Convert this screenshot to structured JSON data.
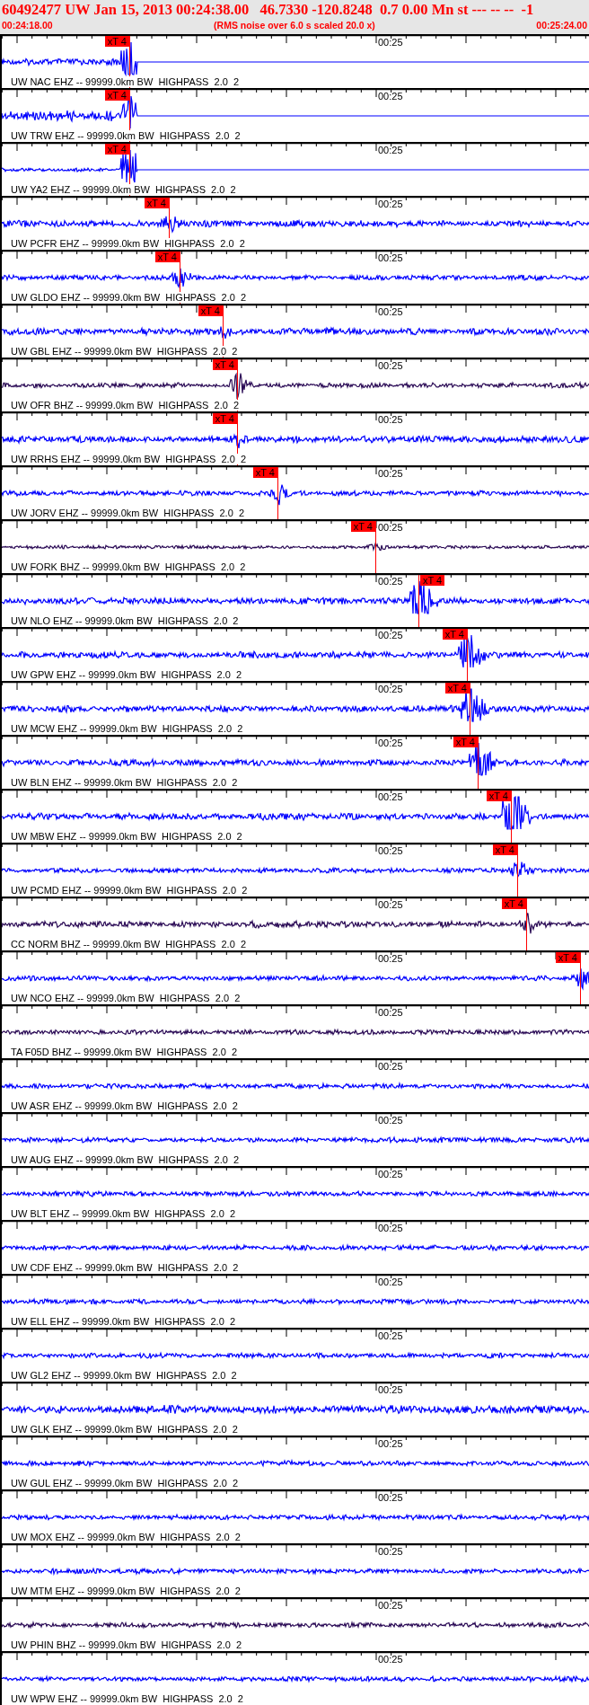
{
  "header": {
    "title": "60492477 UW Jan 15, 2013 00:24:38.00   46.7330 -120.8248  0.7 0.00 Mn st --- -- --  -1",
    "start_time": "00:24:18.00",
    "note": "(RMS noise over 6.0 s scaled 20.0 x)",
    "end_time": "00:25:24.00"
  },
  "traces": [
    {
      "label": "UW NAC EHZ -- 99999.0km BW  HIGHPASS  2.0  2",
      "tick_label": "00:25",
      "pick": "xT 4",
      "color": "#0000ff"
    },
    {
      "label": "UW TRW EHZ -- 99999.0km BW  HIGHPASS  2.0  2",
      "tick_label": "00:25",
      "pick": "xT 4",
      "color": "#0000ff"
    },
    {
      "label": "UW YA2 EHZ -- 99999.0km BW  HIGHPASS  2.0  2",
      "tick_label": "00:25",
      "pick": "xT 4",
      "color": "#0000ff"
    },
    {
      "label": "UW PCFR EHZ -- 99999.0km BW  HIGHPASS  2.0  2",
      "tick_label": "00:25",
      "pick": "xT 4",
      "color": "#0000ff"
    },
    {
      "label": "UW GLDO EHZ -- 99999.0km BW  HIGHPASS  2.0  2",
      "tick_label": "00:25",
      "pick": "xT 4",
      "color": "#0000ff"
    },
    {
      "label": "UW GBL EHZ -- 99999.0km BW  HIGHPASS  2.0  2",
      "tick_label": "00:25",
      "pick": "xT 4",
      "color": "#0000ff"
    },
    {
      "label": "UW OFR BHZ -- 99999.0km BW  HIGHPASS  2.0  2",
      "tick_label": "00:25",
      "pick": "xT 4",
      "color": "#2a0a55"
    },
    {
      "label": "UW RRHS EHZ -- 99999.0km BW  HIGHPASS  2.0  2",
      "tick_label": "00:25",
      "pick": "xT 4",
      "color": "#0000ff"
    },
    {
      "label": "UW JORV EHZ -- 99999.0km BW  HIGHPASS  2.0  2",
      "tick_label": "00:25",
      "pick": "xT 4",
      "color": "#0000ff"
    },
    {
      "label": "UW FORK BHZ -- 99999.0km BW  HIGHPASS  2.0  2",
      "tick_label": "00:25",
      "pick": "xT 4",
      "color": "#2a0a55"
    },
    {
      "label": "UW NLO EHZ -- 99999.0km BW  HIGHPASS  2.0  2",
      "tick_label": "00:25",
      "pick": "xT 4",
      "color": "#0000ff"
    },
    {
      "label": "UW GPW EHZ -- 99999.0km BW  HIGHPASS  2.0  2",
      "tick_label": "00:25",
      "pick": "xT 4",
      "color": "#0000ff"
    },
    {
      "label": "UW MCW EHZ -- 99999.0km BW  HIGHPASS  2.0  2",
      "tick_label": "00:25",
      "pick": "xT 4",
      "color": "#0000ff"
    },
    {
      "label": "UW BLN EHZ -- 99999.0km BW  HIGHPASS  2.0  2",
      "tick_label": "00:25",
      "pick": "xT 4",
      "color": "#0000ff"
    },
    {
      "label": "UW MBW EHZ -- 99999.0km BW  HIGHPASS  2.0  2",
      "tick_label": "00:25",
      "pick": "xT 4",
      "color": "#0000ff"
    },
    {
      "label": "UW PCMD EHZ -- 99999.0km BW  HIGHPASS  2.0  2",
      "tick_label": "00:25",
      "pick": "xT 4",
      "color": "#0000ff"
    },
    {
      "label": "CC NORM BHZ -- 99999.0km BW  HIGHPASS  2.0  2",
      "tick_label": "00:25",
      "pick": "xT 4",
      "color": "#2a0a55"
    },
    {
      "label": "UW NCO EHZ -- 99999.0km BW  HIGHPASS  2.0  2",
      "tick_label": "00:25",
      "pick": "xT 4",
      "color": "#0000ff"
    },
    {
      "label": "TA F05D BHZ -- 99999.0km BW  HIGHPASS  2.0  2",
      "tick_label": "00:25",
      "color": "#2a0a55"
    },
    {
      "label": "UW ASR EHZ -- 99999.0km BW  HIGHPASS  2.0  2",
      "tick_label": "00:25",
      "color": "#0000ff"
    },
    {
      "label": "UW AUG EHZ -- 99999.0km BW  HIGHPASS  2.0  2",
      "tick_label": "00:25",
      "color": "#0000ff"
    },
    {
      "label": "UW BLT EHZ -- 99999.0km BW  HIGHPASS  2.0  2",
      "tick_label": "00:25",
      "color": "#0000ff"
    },
    {
      "label": "UW CDF EHZ -- 99999.0km BW  HIGHPASS  2.0  2",
      "tick_label": "00:25",
      "color": "#0000ff"
    },
    {
      "label": "UW ELL EHZ -- 99999.0km BW  HIGHPASS  2.0  2",
      "tick_label": "00:25",
      "color": "#0000ff"
    },
    {
      "label": "UW GL2 EHZ -- 99999.0km BW  HIGHPASS  2.0  2",
      "tick_label": "00:25",
      "color": "#0000ff"
    },
    {
      "label": "UW GLK EHZ -- 99999.0km BW  HIGHPASS  2.0  2",
      "tick_label": "00:25",
      "color": "#0000ff"
    },
    {
      "label": "UW GUL EHZ -- 99999.0km BW  HIGHPASS  2.0  2",
      "tick_label": "00:25",
      "color": "#0000ff"
    },
    {
      "label": "UW MOX EHZ -- 99999.0km BW  HIGHPASS  2.0  2",
      "tick_label": "00:25",
      "color": "#0000ff"
    },
    {
      "label": "UW MTM EHZ -- 99999.0km BW  HIGHPASS  2.0  2",
      "tick_label": "00:25",
      "color": "#0000ff"
    },
    {
      "label": "UW PHIN BHZ -- 99999.0km BW  HIGHPASS  2.0  2",
      "tick_label": "00:25",
      "color": "#2a0a55"
    },
    {
      "label": "UW WPW EHZ -- 99999.0km BW  HIGHPASS  2.0  2",
      "tick_label": "00:25",
      "color": "#0000ff"
    }
  ]
}
